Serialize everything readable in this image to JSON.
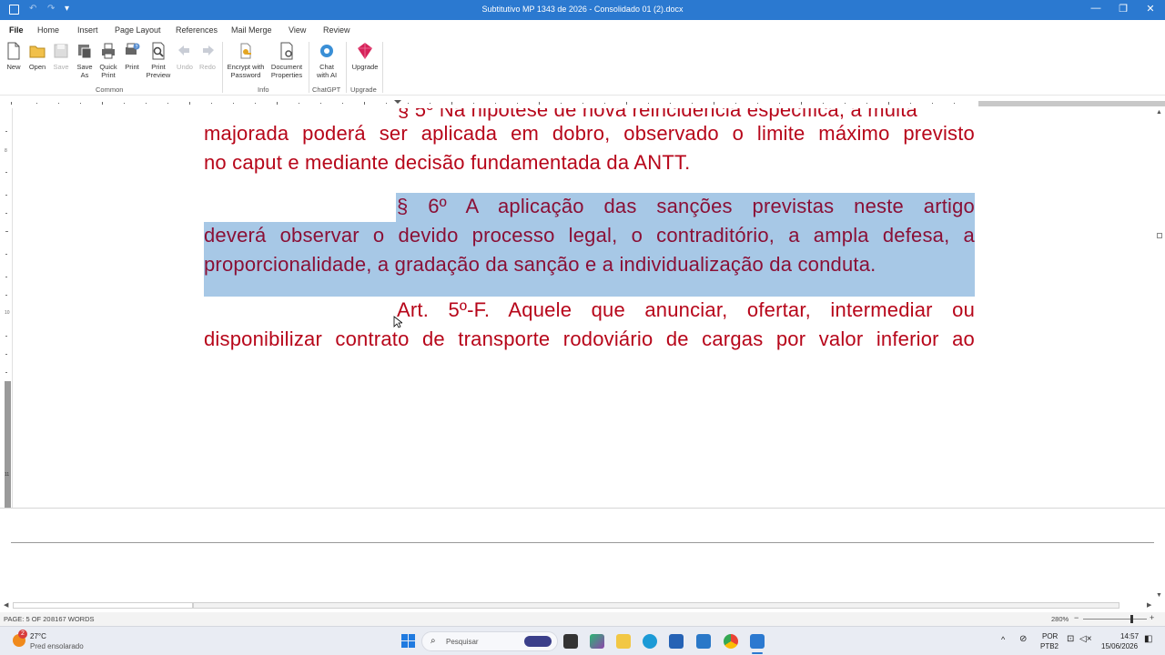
{
  "window": {
    "title": "Subtitutivo MP 1343 de 2026 - Consolidado 01 (2).docx",
    "qa_undo": "↶",
    "qa_redo": "↷",
    "qa_more": "▾",
    "minimize": "—",
    "restore": "❐",
    "close": "✕"
  },
  "tabs": [
    "File",
    "Home",
    "Insert",
    "Page Layout",
    "References",
    "Mail Merge",
    "View",
    "Review"
  ],
  "ribbon": {
    "buttons": {
      "new": "New",
      "open": "Open",
      "save": "Save",
      "save_as_1": "Save",
      "save_as_2": "As",
      "quick_print_1": "Quick",
      "quick_print_2": "Print",
      "print": "Print",
      "print_preview_1": "Print",
      "print_preview_2": "Preview",
      "undo": "Undo",
      "redo": "Redo",
      "encrypt_1": "Encrypt with",
      "encrypt_2": "Password",
      "doc_props_1": "Document",
      "doc_props_2": "Properties",
      "chat_1": "Chat",
      "chat_2": "with AI",
      "upgrade": "Upgrade"
    },
    "groups": {
      "common": "Common",
      "info": "Info",
      "chatgpt": "ChatGPT",
      "upgrade": "Upgrade"
    }
  },
  "document": {
    "partial_top": "§ 5º Na hipótese de nova reincidência específica, a multa",
    "p1_line1": "majorada poderá ser aplicada em dobro, observado o limite máximo previsto",
    "p1_line2": "no caput e mediante decisão fundamentada da ANTT.",
    "p2_line1": "§ 6º A aplicação das sanções previstas neste artigo",
    "p2_line2": "deverá observar o devido processo legal, o contraditório, a ampla defesa, a",
    "p2_line3": "proporcionalidade, a gradação da sanção e a individualização da conduta.",
    "p3_line1": "Art. 5º-F. Aquele que anunciar, ofertar, intermediar ou",
    "p3_line2": "disponibilizar contrato de transporte rodoviário de cargas por valor inferior ao",
    "text_color": "#b7061a",
    "highlight_color": "#a7c8e6"
  },
  "vruler_labels": [
    "8",
    "10",
    "11"
  ],
  "status": {
    "page": "PAGE: 5 OF 20",
    "words": "8167 WORDS",
    "zoom": "280%"
  },
  "taskbar": {
    "weather_badge": "2",
    "weather_temp": "27°C",
    "weather_desc": "Pred ensolarado",
    "search_placeholder": "Pesquisar",
    "lang_1": "POR",
    "lang_2": "PTB2",
    "time": "14:57",
    "date": "15/06/2026"
  }
}
